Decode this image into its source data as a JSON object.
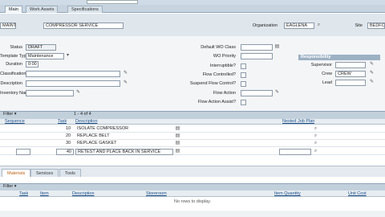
{
  "tabs": [
    {
      "label": "Main"
    },
    {
      "label": "Work Assets"
    },
    {
      "label": "Specifications"
    }
  ],
  "header": {
    "job_plan_id": "MAINT4A",
    "description": "COMPRESSOR SERVICE",
    "organization_label": "Organization",
    "organization_value": "EAGLENA",
    "site_label": "Site",
    "site_value": "BEDFO"
  },
  "form": {
    "status_label": "Status",
    "status_value": "DRAFT",
    "template_type_label": "Template Type",
    "template_type_value": "Maintenance",
    "duration_label": "Duration",
    "duration_value": "0:00",
    "classification_label": "Classification",
    "description_label": "Description",
    "inventory_name_label": "Inventory Name",
    "default_wo_class_label": "Default WO Class",
    "wo_priority_label": "WO Priority",
    "interruptible_label": "Interruptible?",
    "flow_controlled_label": "Flow Controlled?",
    "suspend_flow_label": "Suspend Flow Control?",
    "flow_action_label": "Flow Action",
    "flow_action_assist_label": "Flow Action Assist?",
    "responsibility_title": "Responsibility",
    "supervisor_label": "Supervisor",
    "crew_label": "Crew",
    "crew_value": "CREW",
    "lead_label": "Lead"
  },
  "tasks": {
    "toolbar_label": "Filter",
    "pager": "1 - 4 of 4",
    "columns": {
      "sequence": "Sequence",
      "task": "Task",
      "description": "Description",
      "nested_job_plan": "Nested Job Plan"
    },
    "rows": [
      {
        "task": "10",
        "description": "ISOLATE COMPRESSOR"
      },
      {
        "task": "20",
        "description": "REPLACE BELT"
      },
      {
        "task": "30",
        "description": "REPLACE GASKET"
      },
      {
        "task": "40",
        "description": "RETEST AND PLACE BACK IN SERVICE"
      }
    ]
  },
  "subtabs": [
    {
      "label": "Materials"
    },
    {
      "label": "Services"
    },
    {
      "label": "Tools"
    }
  ],
  "materials": {
    "toolbar_label": "Filter",
    "columns": {
      "task": "Task",
      "item": "Item",
      "description": "Description",
      "storeroom": "Storeroom",
      "item_quantity": "Item Quantity",
      "unit_cost": "Unit Cost"
    },
    "empty_message": "No rows to display."
  },
  "colors": {
    "accent": "#9db1c4",
    "tab_bar": "#c7d3df",
    "header_band": "#dfe6ec"
  }
}
